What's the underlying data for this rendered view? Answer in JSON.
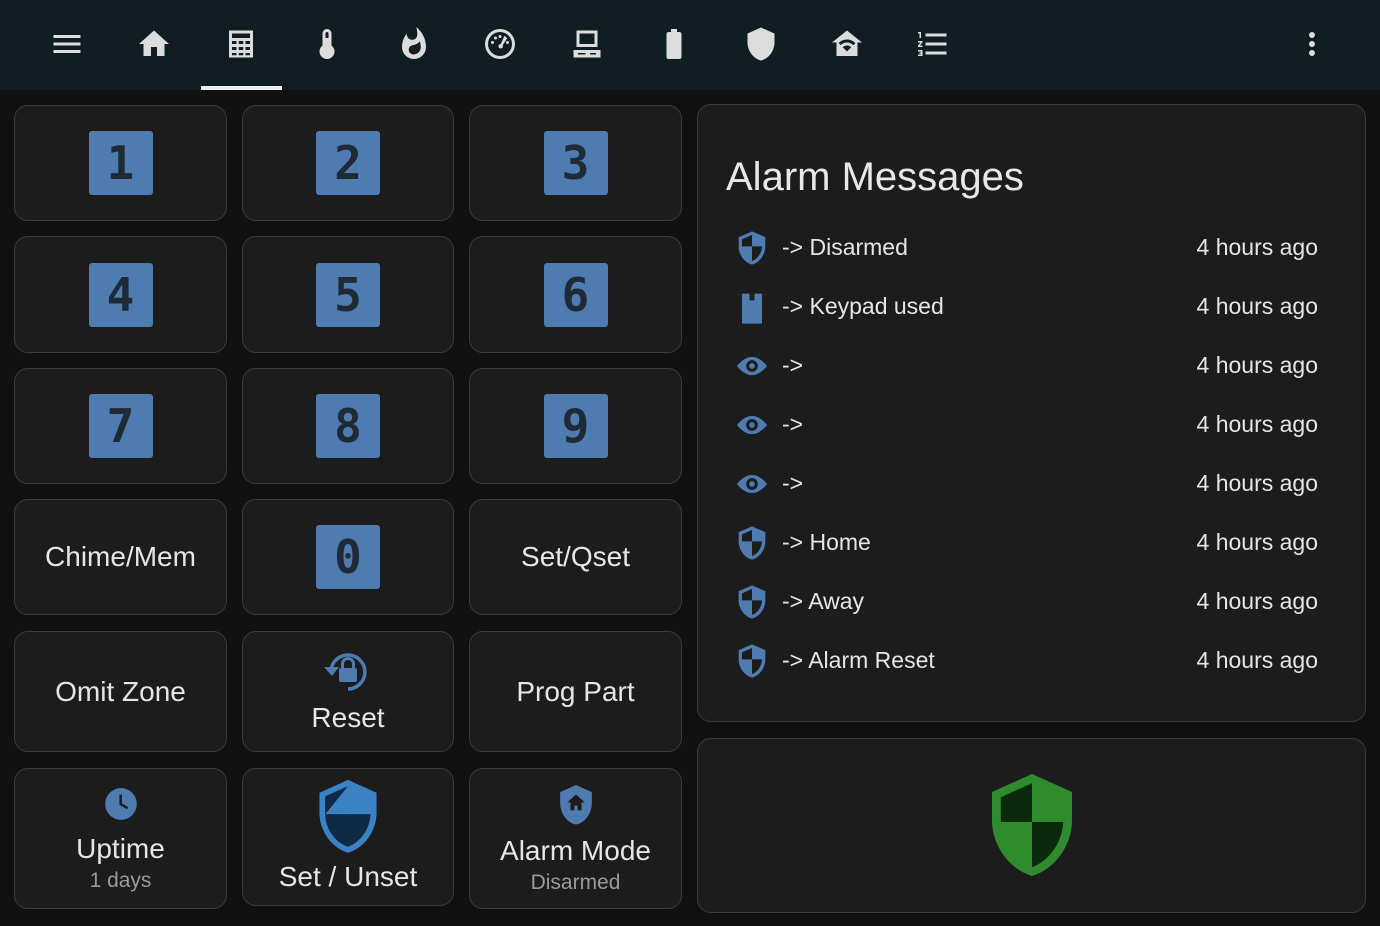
{
  "toolbar": {
    "icons": [
      "menu-icon",
      "home-icon",
      "calculator-icon",
      "thermometer-icon",
      "fire-icon",
      "gauge-icon",
      "computer-icon",
      "battery-icon",
      "shield-icon",
      "wifi-home-icon",
      "numbered-list-icon",
      "more-vert-icon"
    ],
    "active_tab": "calculator-icon"
  },
  "keypad": {
    "digits": [
      "1",
      "2",
      "3",
      "4",
      "5",
      "6",
      "7",
      "8",
      "9",
      "0"
    ],
    "chime_mem": "Chime/Mem",
    "set_qset": "Set/Qset",
    "omit_zone": "Omit Zone",
    "reset": "Reset",
    "prog_part": "Prog Part",
    "uptime": {
      "label": "Uptime",
      "value": "1 days"
    },
    "set_unset": "Set / Unset",
    "alarm_mode": {
      "label": "Alarm Mode",
      "value": "Disarmed"
    }
  },
  "alarm_messages": {
    "title": "Alarm Messages",
    "rows": [
      {
        "icon": "shield-half-icon",
        "text": "-> Disarmed",
        "time": "4 hours ago"
      },
      {
        "icon": "keypad-icon",
        "text": "-> Keypad used",
        "time": "4 hours ago"
      },
      {
        "icon": "eye-icon",
        "text": "->",
        "time": "4 hours ago"
      },
      {
        "icon": "eye-icon",
        "text": "->",
        "time": "4 hours ago"
      },
      {
        "icon": "eye-icon",
        "text": "->",
        "time": "4 hours ago"
      },
      {
        "icon": "shield-half-icon",
        "text": "-> Home",
        "time": "4 hours ago"
      },
      {
        "icon": "shield-half-icon",
        "text": "-> Away",
        "time": "4 hours ago"
      },
      {
        "icon": "shield-half-icon",
        "text": "-> Alarm Reset",
        "time": "4 hours ago"
      }
    ]
  },
  "status_icon": "shield-green-icon",
  "colors": {
    "accent_blue": "#4e7bb0",
    "status_green": "#2e8b2e",
    "topbar": "#101e24",
    "card": "#1c1c1c"
  }
}
